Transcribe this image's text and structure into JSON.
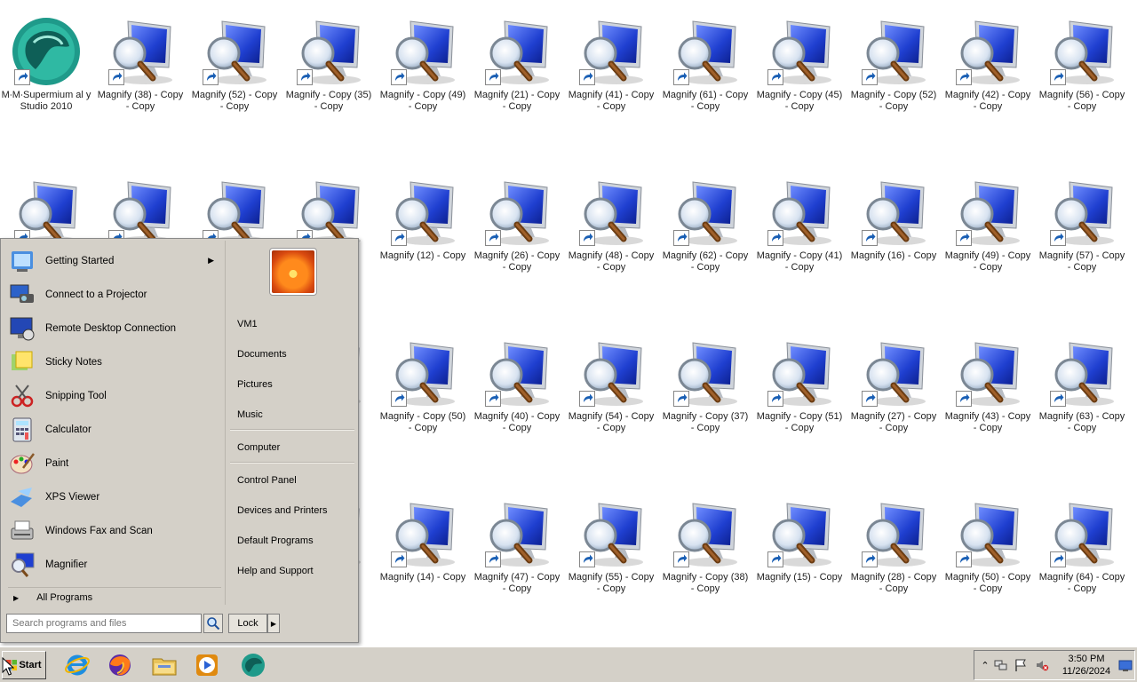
{
  "desktop": {
    "icons": [
      {
        "label": "M∙M∙Supermium al y Studio 2010",
        "kind": "app"
      },
      {
        "label": "Magnify (38) - Copy - Copy",
        "kind": "magnify"
      },
      {
        "label": "Magnify (52) - Copy - Copy",
        "kind": "magnify"
      },
      {
        "label": "Magnify - Copy (35) - Copy",
        "kind": "magnify"
      },
      {
        "label": "Magnify - Copy (49) - Copy",
        "kind": "magnify"
      },
      {
        "label": "Magnify (21) - Copy - Copy",
        "kind": "magnify"
      },
      {
        "label": "Magnify (41) - Copy - Copy",
        "kind": "magnify"
      },
      {
        "label": "Magnify (61) - Copy - Copy",
        "kind": "magnify"
      },
      {
        "label": "Magnify - Copy (45) - Copy",
        "kind": "magnify"
      },
      {
        "label": "Magnify - Copy (52) - Copy",
        "kind": "magnify"
      },
      {
        "label": "Magnify (42) - Copy - Copy",
        "kind": "magnify"
      },
      {
        "label": "Magnify (56) - Copy - Copy",
        "kind": "magnify"
      },
      {
        "label": "",
        "kind": "magnify"
      },
      {
        "label": "",
        "kind": "magnify"
      },
      {
        "label": "",
        "kind": "magnify"
      },
      {
        "label": "36)",
        "kind": "magnify"
      },
      {
        "label": "Magnify (12) - Copy",
        "kind": "magnify"
      },
      {
        "label": "Magnify (26) - Copy - Copy",
        "kind": "magnify"
      },
      {
        "label": "Magnify (48) - Copy - Copy",
        "kind": "magnify"
      },
      {
        "label": "Magnify (62) - Copy - Copy",
        "kind": "magnify"
      },
      {
        "label": "Magnify - Copy (41) - Copy",
        "kind": "magnify"
      },
      {
        "label": "Magnify (16) - Copy",
        "kind": "magnify"
      },
      {
        "label": "Magnify (49) - Copy - Copy",
        "kind": "magnify"
      },
      {
        "label": "Magnify (57) - Copy - Copy",
        "kind": "magnify"
      },
      {
        "label": "43)",
        "kind": "magnify"
      },
      {
        "label": "Magnify - Copy (50) - Copy",
        "kind": "magnify"
      },
      {
        "label": "Magnify (40) - Copy - Copy",
        "kind": "magnify"
      },
      {
        "label": "Magnify (54) - Copy - Copy",
        "kind": "magnify"
      },
      {
        "label": "Magnify - Copy (37) - Copy",
        "kind": "magnify"
      },
      {
        "label": "Magnify - Copy (51) - Copy",
        "kind": "magnify"
      },
      {
        "label": "Magnify (27) - Copy - Copy",
        "kind": "magnify"
      },
      {
        "label": "Magnify (43) - Copy - Copy",
        "kind": "magnify"
      },
      {
        "label": "Magnify (63) - Copy - Copy",
        "kind": "magnify"
      },
      {
        "label": "44)",
        "kind": "magnify"
      },
      {
        "label": "Magnify (14) - Copy",
        "kind": "magnify"
      },
      {
        "label": "Magnify (47) - Copy - Copy",
        "kind": "magnify"
      },
      {
        "label": "Magnify (55) - Copy - Copy",
        "kind": "magnify"
      },
      {
        "label": "Magnify - Copy (38) - Copy",
        "kind": "magnify"
      },
      {
        "label": "Magnify (15) - Copy",
        "kind": "magnify"
      },
      {
        "label": "Magnify (28) - Copy - Copy",
        "kind": "magnify"
      },
      {
        "label": "Magnify (50) - Copy - Copy",
        "kind": "magnify"
      },
      {
        "label": "Magnify (64) - Copy - Copy",
        "kind": "magnify"
      }
    ]
  },
  "start_menu": {
    "programs": [
      {
        "label": "Getting Started",
        "icon": "getting-started-icon",
        "submenu": true
      },
      {
        "label": "Connect to a Projector",
        "icon": "projector-icon"
      },
      {
        "label": "Remote Desktop Connection",
        "icon": "remote-desktop-icon"
      },
      {
        "label": "Sticky Notes",
        "icon": "sticky-notes-icon"
      },
      {
        "label": "Snipping Tool",
        "icon": "snipping-tool-icon"
      },
      {
        "label": "Calculator",
        "icon": "calculator-icon"
      },
      {
        "label": "Paint",
        "icon": "paint-icon"
      },
      {
        "label": "XPS Viewer",
        "icon": "xps-viewer-icon"
      },
      {
        "label": "Windows Fax and Scan",
        "icon": "fax-scan-icon"
      },
      {
        "label": "Magnifier",
        "icon": "magnifier-icon"
      }
    ],
    "all_programs": "All Programs",
    "right_links": {
      "user": "VM1",
      "documents": "Documents",
      "pictures": "Pictures",
      "music": "Music",
      "computer": "Computer",
      "control_panel": "Control Panel",
      "devices": "Devices and Printers",
      "default_programs": "Default Programs",
      "help": "Help and Support"
    },
    "search_placeholder": "Search programs and files",
    "lock_label": "Lock"
  },
  "taskbar": {
    "start_label": "Start",
    "apps": [
      "internet-explorer-icon",
      "firefox-icon",
      "file-explorer-icon",
      "media-player-icon",
      "supermium-icon"
    ],
    "clock_time": "3:50 PM",
    "clock_date": "11/26/2024"
  },
  "colors": {
    "classic_gray": "#d4d0c8",
    "monitor_blue": "#1f3fd0",
    "shortcut_arrow": "#1a5fb4"
  }
}
